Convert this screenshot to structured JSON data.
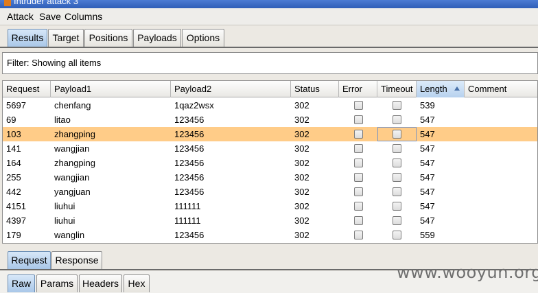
{
  "window": {
    "title": "Intruder attack 3"
  },
  "menu": [
    "Attack",
    "Save",
    "Columns"
  ],
  "tabs": [
    "Results",
    "Target",
    "Positions",
    "Payloads",
    "Options"
  ],
  "active_tab": "Results",
  "filter": {
    "text": "Filter: Showing all items"
  },
  "table": {
    "columns": [
      "Request",
      "Payload1",
      "Payload2",
      "Status",
      "Error",
      "Timeout",
      "Length",
      "Comment"
    ],
    "sorted_column": "Length",
    "sort_direction": "ascending",
    "rows": [
      {
        "request": "5697",
        "payload1": "chenfang",
        "payload2": "1qaz2wsx",
        "status": "302",
        "error": false,
        "timeout": false,
        "length": "539",
        "comment": ""
      },
      {
        "request": "69",
        "payload1": "litao",
        "payload2": "123456",
        "status": "302",
        "error": false,
        "timeout": false,
        "length": "547",
        "comment": ""
      },
      {
        "request": "103",
        "payload1": "zhangping",
        "payload2": "123456",
        "status": "302",
        "error": false,
        "timeout": false,
        "length": "547",
        "comment": "",
        "selected": true
      },
      {
        "request": "141",
        "payload1": "wangjian",
        "payload2": "123456",
        "status": "302",
        "error": false,
        "timeout": false,
        "length": "547",
        "comment": ""
      },
      {
        "request": "164",
        "payload1": "zhangping",
        "payload2": "123456",
        "status": "302",
        "error": false,
        "timeout": false,
        "length": "547",
        "comment": ""
      },
      {
        "request": "255",
        "payload1": "wangjian",
        "payload2": "123456",
        "status": "302",
        "error": false,
        "timeout": false,
        "length": "547",
        "comment": ""
      },
      {
        "request": "442",
        "payload1": "yangjuan",
        "payload2": "123456",
        "status": "302",
        "error": false,
        "timeout": false,
        "length": "547",
        "comment": ""
      },
      {
        "request": "4151",
        "payload1": "liuhui",
        "payload2": "111111",
        "status": "302",
        "error": false,
        "timeout": false,
        "length": "547",
        "comment": ""
      },
      {
        "request": "4397",
        "payload1": "liuhui",
        "payload2": "111111",
        "status": "302",
        "error": false,
        "timeout": false,
        "length": "547",
        "comment": ""
      },
      {
        "request": "179",
        "payload1": "wanglin",
        "payload2": "123456",
        "status": "302",
        "error": false,
        "timeout": false,
        "length": "559",
        "comment": ""
      }
    ]
  },
  "detail_tabs": [
    "Request",
    "Response"
  ],
  "active_detail_tab": "Request",
  "view_tabs": [
    "Raw",
    "Params",
    "Headers",
    "Hex"
  ],
  "active_view_tab": "Raw",
  "watermark": "www.wooyun.org",
  "colors": {
    "selected_row": "#ffcc88",
    "active_tab": "#a9c7e8"
  }
}
